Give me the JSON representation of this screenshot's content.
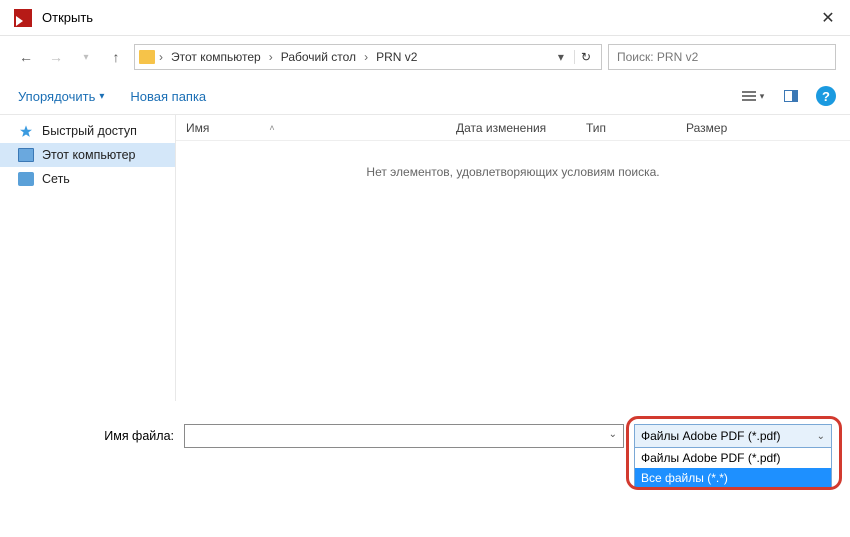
{
  "title": "Открыть",
  "nav": {
    "crumbs": [
      "Этот компьютер",
      "Рабочий стол",
      "PRN v2"
    ]
  },
  "search": {
    "placeholder": "Поиск: PRN v2"
  },
  "toolbar": {
    "organize": "Упорядочить",
    "newfolder": "Новая папка"
  },
  "sidebar": {
    "items": [
      {
        "label": "Быстрый доступ"
      },
      {
        "label": "Этот компьютер"
      },
      {
        "label": "Сеть"
      }
    ]
  },
  "columns": {
    "name": "Имя",
    "date": "Дата изменения",
    "type": "Тип",
    "size": "Размер"
  },
  "empty_text": "Нет элементов, удовлетворяющих условиям поиска.",
  "filename_label": "Имя файла:",
  "filter": {
    "selected": "Файлы Adobe PDF (*.pdf)",
    "options": [
      "Файлы Adobe PDF (*.pdf)",
      "Все файлы (*.*)"
    ]
  }
}
